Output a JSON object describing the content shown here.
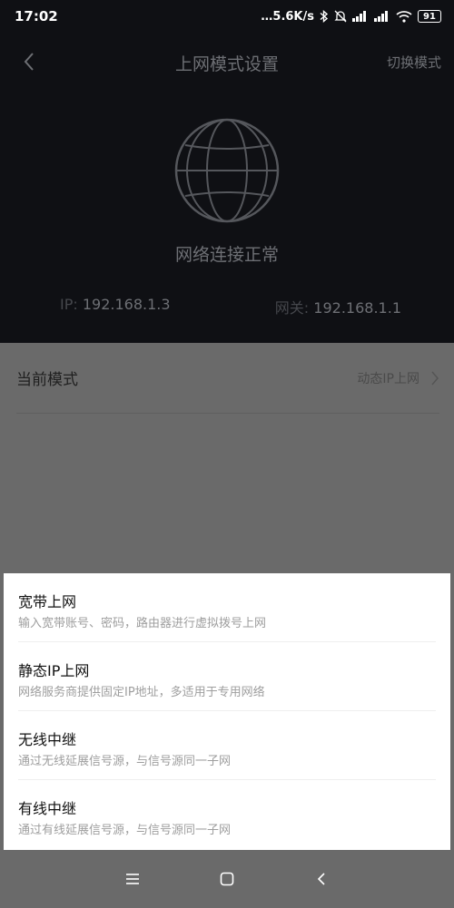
{
  "statusbar": {
    "time": "17:02",
    "net_speed": "…5.6K/s",
    "battery": "91"
  },
  "header": {
    "title": "上网模式设置",
    "switch_label": "切换模式",
    "connection_status": "网络连接正常",
    "ip_label": "IP:",
    "ip_value": "192.168.1.3",
    "gateway_label": "网关:",
    "gateway_value": "192.168.1.1"
  },
  "current_mode": {
    "label": "当前模式",
    "value": "动态IP上网"
  },
  "sheet": {
    "options": [
      {
        "title": "宽带上网",
        "desc": "输入宽带账号、密码，路由器进行虚拟拨号上网"
      },
      {
        "title": "静态IP上网",
        "desc": "网络服务商提供固定IP地址，多适用于专用网络"
      },
      {
        "title": "无线中继",
        "desc": "通过无线延展信号源，与信号源同一子网"
      },
      {
        "title": "有线中继",
        "desc": "通过有线延展信号源，与信号源同一子网"
      }
    ]
  }
}
